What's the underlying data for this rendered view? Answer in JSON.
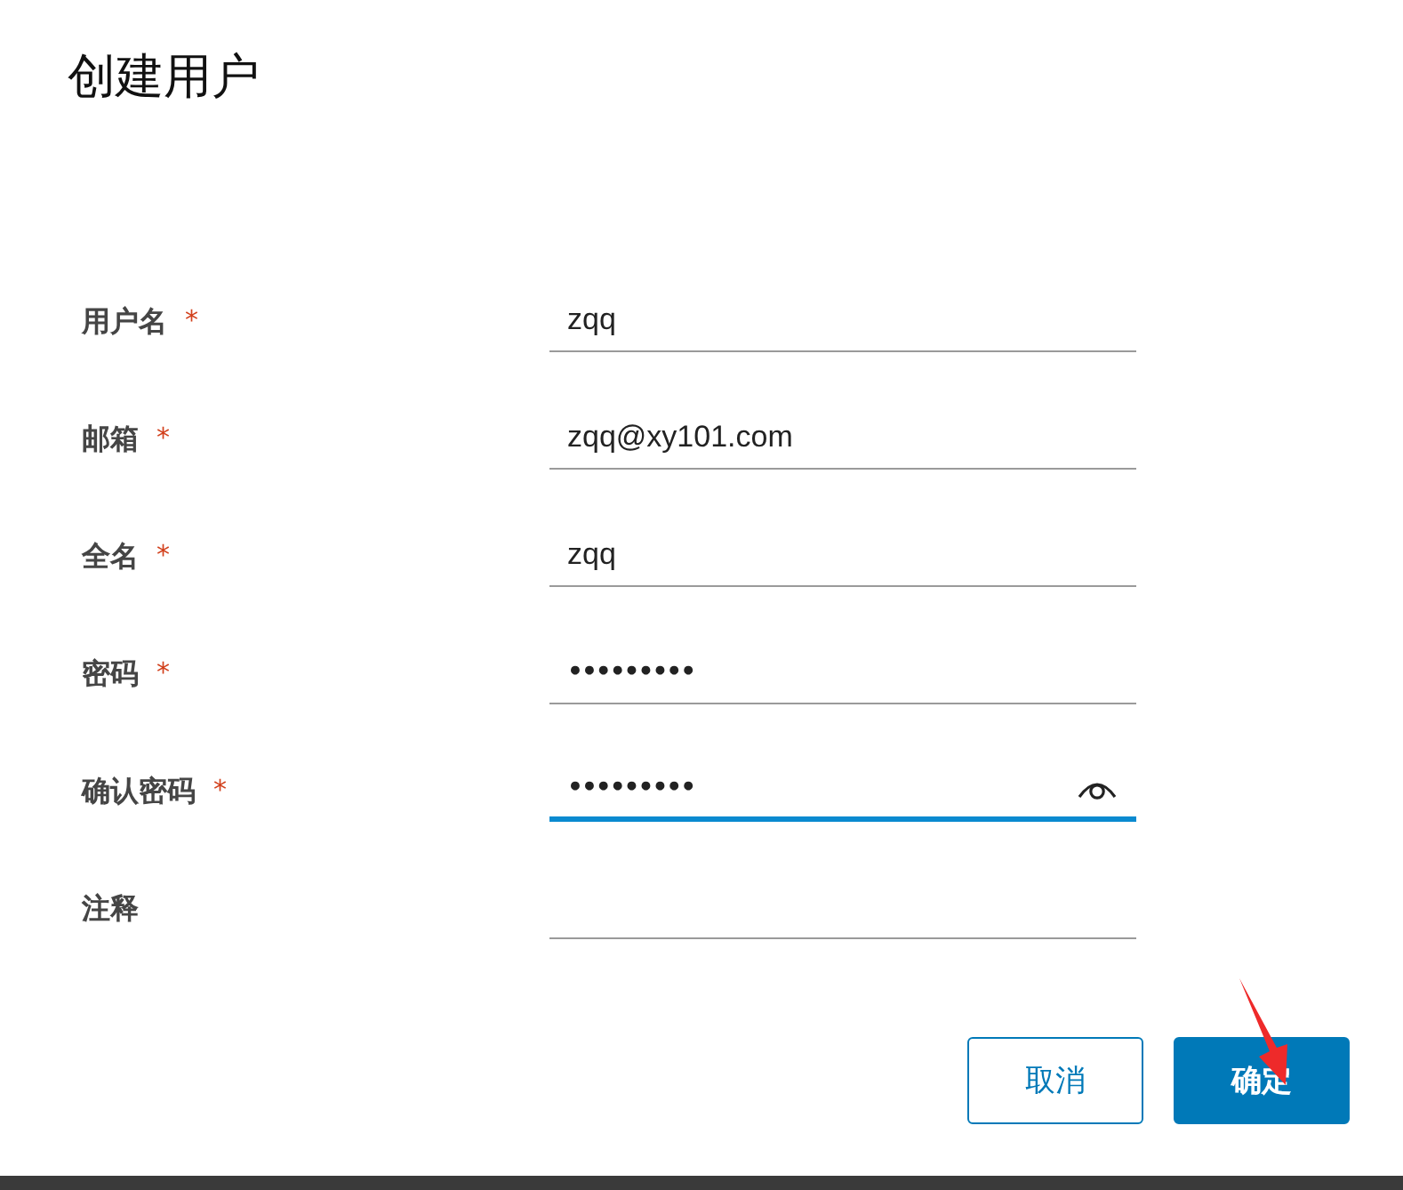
{
  "dialog": {
    "title": "创建用户"
  },
  "fields": [
    {
      "label": "用户名",
      "required_mark": "*",
      "kind": "text",
      "value": "zqq",
      "focused": false
    },
    {
      "label": "邮箱",
      "required_mark": "*",
      "kind": "text",
      "value": "zqq@xy101.com",
      "focused": false
    },
    {
      "label": "全名",
      "required_mark": "*",
      "kind": "text",
      "value": "zqq",
      "focused": false
    },
    {
      "label": "密码",
      "required_mark": "*",
      "kind": "password",
      "value": "•••••••••",
      "focused": false
    },
    {
      "label": "确认密码",
      "required_mark": "*",
      "kind": "password",
      "value": "•••••••••",
      "focused": true,
      "reveal_icon": true
    },
    {
      "label": "注释",
      "kind": "text",
      "focused": false
    }
  ],
  "buttons": [
    {
      "label": "取消",
      "kind": "secondary"
    },
    {
      "label": "确定",
      "kind": "primary"
    }
  ]
}
